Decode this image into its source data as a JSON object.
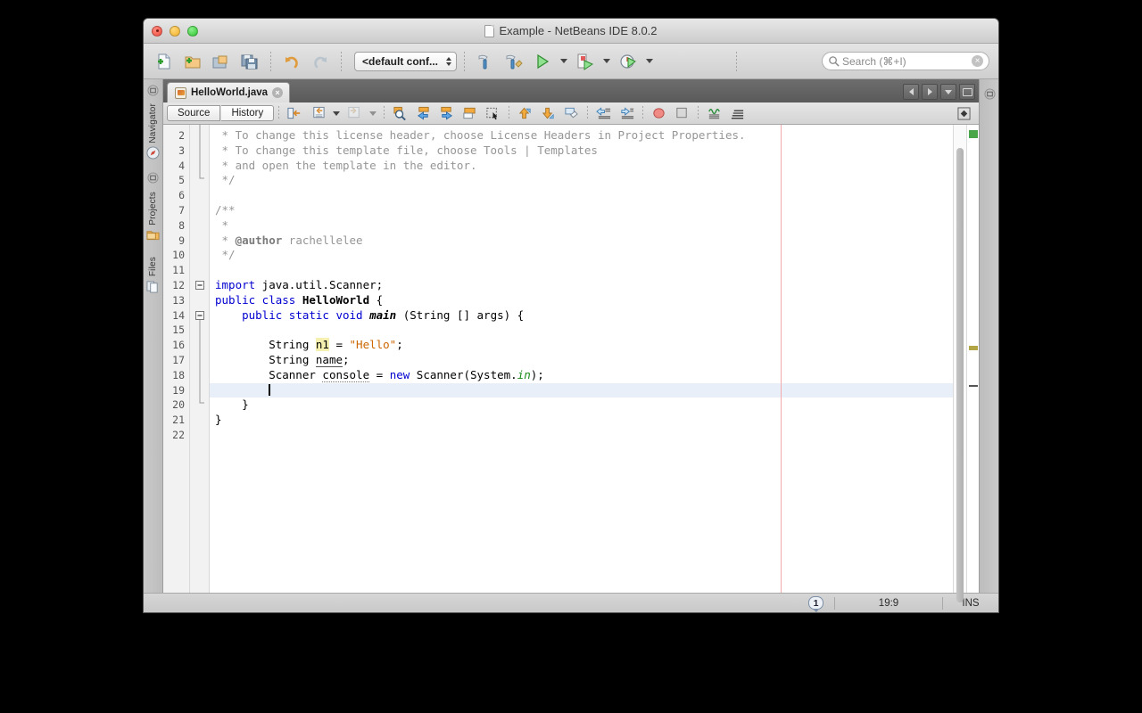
{
  "window": {
    "title": "Example - NetBeans IDE 8.0.2",
    "doc_icon": "document-icon",
    "controls": {
      "close": "close-window",
      "minimize": "minimize-window",
      "zoom": "zoom-window"
    }
  },
  "toolbar": {
    "buttons": [
      {
        "name": "new-file-button",
        "icon": "new-file-icon",
        "label": "New File"
      },
      {
        "name": "new-project-button",
        "icon": "new-project-icon",
        "label": "New Project"
      },
      {
        "name": "open-project-button",
        "icon": "open-project-icon",
        "label": "Open Project"
      },
      {
        "name": "save-all-button",
        "icon": "save-all-icon",
        "label": "Save All"
      },
      {
        "name": "undo-button",
        "icon": "undo-icon",
        "label": "Undo"
      },
      {
        "name": "redo-button",
        "icon": "redo-icon",
        "label": "Redo"
      },
      {
        "name": "build-project-button",
        "icon": "hammer-icon",
        "label": "Build Project"
      },
      {
        "name": "clean-build-button",
        "icon": "hammer-broom-icon",
        "label": "Clean and Build Project"
      },
      {
        "name": "run-project-button",
        "icon": "run-icon",
        "label": "Run Project"
      },
      {
        "name": "debug-project-button",
        "icon": "debug-icon",
        "label": "Debug Project"
      },
      {
        "name": "profile-project-button",
        "icon": "profile-icon",
        "label": "Profile Project"
      }
    ],
    "config_combo": {
      "value": "<default conf...",
      "name": "configuration-combo"
    },
    "search": {
      "placeholder": "Search (⌘+I)",
      "value": "",
      "icon": "search-icon",
      "clear_icon": "clear-icon"
    }
  },
  "left_dock": {
    "tabs": [
      {
        "label": "Navigator",
        "icon": "compass-icon"
      },
      {
        "label": "Projects",
        "icon": "folder-icon"
      },
      {
        "label": "Files",
        "icon": "files-icon"
      }
    ]
  },
  "tabstrip": {
    "tabs": [
      {
        "label": "HelloWorld.java",
        "icon": "java-file-icon",
        "close": "close-tab-icon",
        "active": true
      }
    ],
    "controls": [
      {
        "name": "scroll-tabs-left-button",
        "icon": "chevron-left-icon"
      },
      {
        "name": "scroll-tabs-right-button",
        "icon": "chevron-right-icon"
      },
      {
        "name": "tab-list-button",
        "icon": "chevron-down-icon"
      },
      {
        "name": "maximize-window-button",
        "icon": "maximize-icon"
      }
    ]
  },
  "editor_toolbar": {
    "source_label": "Source",
    "history_label": "History",
    "buttons": [
      {
        "name": "last-edit-button",
        "icon": "last-edit-icon"
      },
      {
        "name": "back-button",
        "icon": "back-icon"
      },
      {
        "name": "forward-button",
        "icon": "forward-icon"
      },
      {
        "name": "find-selection-button",
        "icon": "magnifier-icon"
      },
      {
        "name": "find-previous-button",
        "icon": "arrow-left-icon"
      },
      {
        "name": "find-next-button",
        "icon": "arrow-right-icon"
      },
      {
        "name": "toggle-highlight-button",
        "icon": "highlight-icon"
      },
      {
        "name": "toggle-rect-select-button",
        "icon": "rect-select-icon"
      },
      {
        "name": "shift-line-up-button",
        "icon": "arrow-up-icon"
      },
      {
        "name": "shift-line-down-button",
        "icon": "arrow-down-icon"
      },
      {
        "name": "comment-button",
        "icon": "comment-icon"
      },
      {
        "name": "shift-left-button",
        "icon": "shift-left-icon"
      },
      {
        "name": "shift-right-button",
        "icon": "shift-right-icon"
      },
      {
        "name": "toggle-breakpoint-button",
        "icon": "breakpoint-icon"
      },
      {
        "name": "stop-button",
        "icon": "stop-icon"
      },
      {
        "name": "diff-button",
        "icon": "diff-icon"
      },
      {
        "name": "format-button",
        "icon": "format-icon"
      },
      {
        "name": "toggle-toolbar-button",
        "icon": "toolbar-toggle-icon"
      }
    ]
  },
  "editor": {
    "first_visible_line": 2,
    "current_line": 19,
    "lines": [
      {
        "n": 2,
        "segs": [
          {
            "t": " * To change this license header, choose License Headers in Project Properties.",
            "c": "cmt"
          }
        ]
      },
      {
        "n": 3,
        "segs": [
          {
            "t": " * To change this template file, choose Tools | Templates",
            "c": "cmt"
          }
        ]
      },
      {
        "n": 4,
        "segs": [
          {
            "t": " * and open the template in the editor.",
            "c": "cmt"
          }
        ]
      },
      {
        "n": 5,
        "segs": [
          {
            "t": " */",
            "c": "cmt"
          }
        ]
      },
      {
        "n": 6,
        "segs": [
          {
            "t": "",
            "c": ""
          }
        ]
      },
      {
        "n": 7,
        "segs": [
          {
            "t": "/**",
            "c": "cmt"
          }
        ]
      },
      {
        "n": 8,
        "segs": [
          {
            "t": " *",
            "c": "cmt"
          }
        ]
      },
      {
        "n": 9,
        "segs": [
          {
            "t": " * ",
            "c": "cmt"
          },
          {
            "t": "@author",
            "c": "cmtb"
          },
          {
            "t": " rachellelee",
            "c": "cmt"
          }
        ]
      },
      {
        "n": 10,
        "segs": [
          {
            "t": " */",
            "c": "cmt"
          }
        ]
      },
      {
        "n": 11,
        "segs": [
          {
            "t": "",
            "c": ""
          }
        ]
      },
      {
        "n": 12,
        "segs": [
          {
            "t": "import",
            "c": "kw"
          },
          {
            "t": " java.util.Scanner;",
            "c": ""
          }
        ]
      },
      {
        "n": 13,
        "segs": [
          {
            "t": "public class",
            "c": "kw"
          },
          {
            "t": " ",
            "c": ""
          },
          {
            "t": "HelloWorld",
            "c": "cls"
          },
          {
            "t": " {",
            "c": ""
          }
        ]
      },
      {
        "n": 14,
        "segs": [
          {
            "t": "    ",
            "c": ""
          },
          {
            "t": "public static void",
            "c": "kw"
          },
          {
            "t": " ",
            "c": ""
          },
          {
            "t": "main",
            "c": "mth"
          },
          {
            "t": " (String [] args) {",
            "c": ""
          }
        ]
      },
      {
        "n": 15,
        "segs": [
          {
            "t": "",
            "c": ""
          }
        ]
      },
      {
        "n": 16,
        "segs": [
          {
            "t": "        String ",
            "c": ""
          },
          {
            "t": "n1",
            "c": "hl"
          },
          {
            "t": " = ",
            "c": ""
          },
          {
            "t": "\"Hello\"",
            "c": "str"
          },
          {
            "t": ";",
            "c": ""
          }
        ]
      },
      {
        "n": 17,
        "segs": [
          {
            "t": "        String ",
            "c": ""
          },
          {
            "t": "name",
            "c": "und"
          },
          {
            "t": ";",
            "c": ""
          }
        ]
      },
      {
        "n": 18,
        "segs": [
          {
            "t": "        Scanner ",
            "c": ""
          },
          {
            "t": "console",
            "c": "wav"
          },
          {
            "t": " = ",
            "c": ""
          },
          {
            "t": "new",
            "c": "kw"
          },
          {
            "t": " Scanner(System.",
            "c": ""
          },
          {
            "t": "in",
            "c": "fld"
          },
          {
            "t": ");",
            "c": ""
          }
        ]
      },
      {
        "n": 19,
        "segs": [
          {
            "t": "        ",
            "c": ""
          }
        ],
        "current": true,
        "caret": true
      },
      {
        "n": 20,
        "segs": [
          {
            "t": "    }",
            "c": ""
          }
        ]
      },
      {
        "n": 21,
        "segs": [
          {
            "t": "}",
            "c": ""
          }
        ]
      },
      {
        "n": 22,
        "segs": [
          {
            "t": "",
            "c": ""
          }
        ]
      }
    ],
    "fold_markers": [
      {
        "line": 12,
        "type": "collapse-box"
      },
      {
        "line": 14,
        "type": "collapse-box"
      }
    ],
    "annotations": [
      {
        "name": "no-errors-mark",
        "color": "#48a548"
      },
      {
        "name": "warning-mark",
        "color": "#b2a545"
      },
      {
        "name": "occurrence-mark",
        "color": "#555555"
      }
    ]
  },
  "statusbar": {
    "notification_count": "1",
    "cursor_position": "19:9",
    "insert_mode": "INS"
  }
}
